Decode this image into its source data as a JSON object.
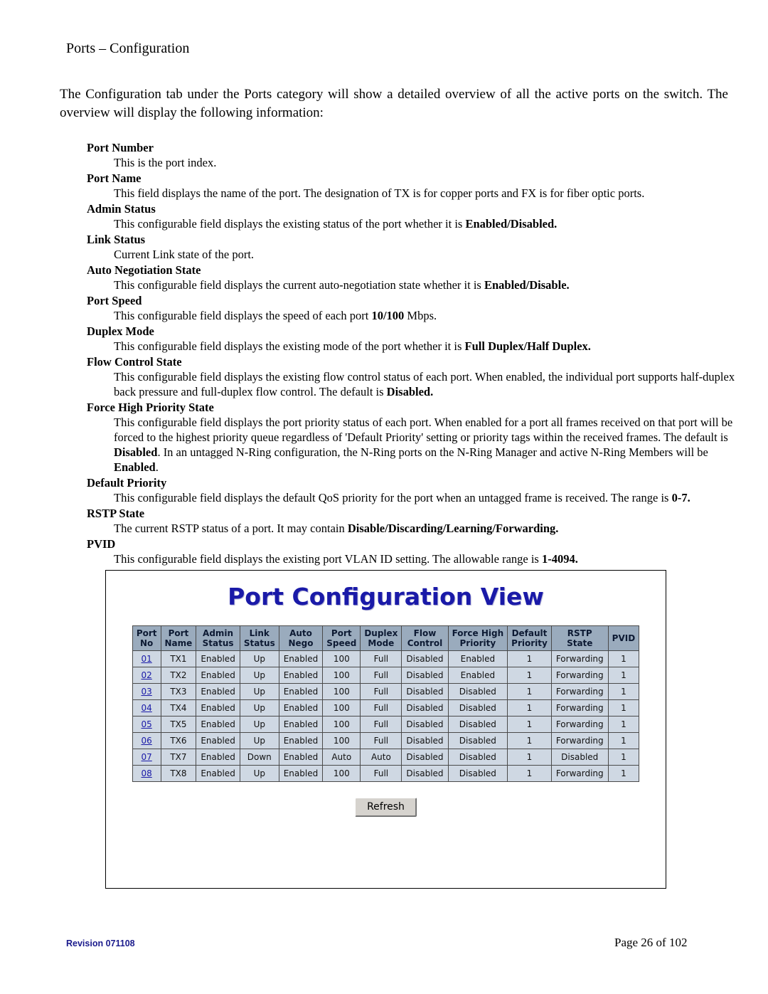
{
  "page": {
    "heading": "Ports – Configuration",
    "intro": "The Configuration tab under the Ports category will show a detailed overview of all the active ports on the switch.  The overview will display the following information:",
    "footer_left": "Revision 071108",
    "footer_right": "Page 26 of 102"
  },
  "definitions": [
    {
      "term": "Port Number",
      "parts": [
        {
          "t": "This is the port index.",
          "b": false
        }
      ]
    },
    {
      "term": "Port Name",
      "parts": [
        {
          "t": "This field displays the name of the port. The designation of TX is for copper ports and FX is for fiber optic ports.",
          "b": false
        }
      ]
    },
    {
      "term": "Admin Status",
      "parts": [
        {
          "t": "This configurable field displays the existing status of the port whether it is ",
          "b": false
        },
        {
          "t": "Enabled/Disabled.",
          "b": true
        }
      ]
    },
    {
      "term": "Link Status",
      "parts": [
        {
          "t": "Current Link state of the port.",
          "b": false
        }
      ]
    },
    {
      "term": "Auto Negotiation State",
      "parts": [
        {
          "t": "This configurable field displays the current auto-negotiation state whether it is ",
          "b": false
        },
        {
          "t": "Enabled/Disable.",
          "b": true
        }
      ]
    },
    {
      "term": "Port Speed",
      "parts": [
        {
          "t": "This configurable field displays the speed of each port ",
          "b": false
        },
        {
          "t": "10/100",
          "b": true
        },
        {
          "t": " Mbps.",
          "b": false
        }
      ]
    },
    {
      "term": "Duplex Mode",
      "parts": [
        {
          "t": "This configurable field displays the existing mode of the port whether it is ",
          "b": false
        },
        {
          "t": "Full Duplex/Half Duplex.",
          "b": true
        }
      ]
    },
    {
      "term": "Flow Control State",
      "parts": [
        {
          "t": "This configurable field displays the existing flow control status of each port. When enabled, the individual port supports half-duplex back pressure and full-duplex flow control. The default is ",
          "b": false
        },
        {
          "t": "Disabled.",
          "b": true
        }
      ]
    },
    {
      "term": "Force High Priority State",
      "parts": [
        {
          "t": "This configurable field displays the port priority status of each port. When enabled for a port all frames received on that port will be forced to the highest priority queue regardless of 'Default Priority' setting or priority tags within the received frames. The default is ",
          "b": false
        },
        {
          "t": "Disabled",
          "b": true
        },
        {
          "t": ". In an untagged N-Ring configuration, the N-Ring ports on the N-Ring Manager and active N-Ring Members will be ",
          "b": false
        },
        {
          "t": "Enabled",
          "b": true
        },
        {
          "t": ".",
          "b": false
        }
      ]
    },
    {
      "term": "Default Priority",
      "parts": [
        {
          "t": "This configurable field displays the default QoS priority for the port when an untagged frame is received. The range is ",
          "b": false
        },
        {
          "t": "0-7.",
          "b": true
        }
      ]
    },
    {
      "term": "RSTP State",
      "parts": [
        {
          "t": "The current RSTP status of a port. It may contain ",
          "b": false
        },
        {
          "t": "Disable/Discarding/Learning/Forwarding.",
          "b": true
        }
      ]
    },
    {
      "term": "PVID",
      "parts": [
        {
          "t": "This configurable field displays the existing port VLAN ID setting. The allowable range is ",
          "b": false
        },
        {
          "t": "1-4094.",
          "b": true
        }
      ]
    }
  ],
  "port_view": {
    "title": "Port Configuration View",
    "refresh_label": "Refresh",
    "columns": [
      {
        "line1": "Port",
        "line2": "No"
      },
      {
        "line1": "Port",
        "line2": "Name"
      },
      {
        "line1": "Admin",
        "line2": "Status"
      },
      {
        "line1": "Link",
        "line2": "Status"
      },
      {
        "line1": "Auto",
        "line2": "Nego"
      },
      {
        "line1": "Port",
        "line2": "Speed"
      },
      {
        "line1": "Duplex",
        "line2": "Mode"
      },
      {
        "line1": "Flow",
        "line2": "Control"
      },
      {
        "line1": "Force High",
        "line2": "Priority"
      },
      {
        "line1": "Default",
        "line2": "Priority"
      },
      {
        "line1": "RSTP",
        "line2": "State"
      },
      {
        "line1": "PVID",
        "line2": ""
      }
    ],
    "rows": [
      {
        "no": "01",
        "name": "TX1",
        "admin": "Enabled",
        "link": "Up",
        "auto": "Enabled",
        "speed": "100",
        "duplex": "Full",
        "flow": "Disabled",
        "force": "Enabled",
        "default": "1",
        "rstp": "Forwarding",
        "pvid": "1"
      },
      {
        "no": "02",
        "name": "TX2",
        "admin": "Enabled",
        "link": "Up",
        "auto": "Enabled",
        "speed": "100",
        "duplex": "Full",
        "flow": "Disabled",
        "force": "Enabled",
        "default": "1",
        "rstp": "Forwarding",
        "pvid": "1"
      },
      {
        "no": "03",
        "name": "TX3",
        "admin": "Enabled",
        "link": "Up",
        "auto": "Enabled",
        "speed": "100",
        "duplex": "Full",
        "flow": "Disabled",
        "force": "Disabled",
        "default": "1",
        "rstp": "Forwarding",
        "pvid": "1"
      },
      {
        "no": "04",
        "name": "TX4",
        "admin": "Enabled",
        "link": "Up",
        "auto": "Enabled",
        "speed": "100",
        "duplex": "Full",
        "flow": "Disabled",
        "force": "Disabled",
        "default": "1",
        "rstp": "Forwarding",
        "pvid": "1"
      },
      {
        "no": "05",
        "name": "TX5",
        "admin": "Enabled",
        "link": "Up",
        "auto": "Enabled",
        "speed": "100",
        "duplex": "Full",
        "flow": "Disabled",
        "force": "Disabled",
        "default": "1",
        "rstp": "Forwarding",
        "pvid": "1"
      },
      {
        "no": "06",
        "name": "TX6",
        "admin": "Enabled",
        "link": "Up",
        "auto": "Enabled",
        "speed": "100",
        "duplex": "Full",
        "flow": "Disabled",
        "force": "Disabled",
        "default": "1",
        "rstp": "Forwarding",
        "pvid": "1"
      },
      {
        "no": "07",
        "name": "TX7",
        "admin": "Enabled",
        "link": "Down",
        "auto": "Enabled",
        "speed": "Auto",
        "duplex": "Auto",
        "flow": "Disabled",
        "force": "Disabled",
        "default": "1",
        "rstp": "Disabled",
        "pvid": "1"
      },
      {
        "no": "08",
        "name": "TX8",
        "admin": "Enabled",
        "link": "Up",
        "auto": "Enabled",
        "speed": "100",
        "duplex": "Full",
        "flow": "Disabled",
        "force": "Disabled",
        "default": "1",
        "rstp": "Forwarding",
        "pvid": "1"
      }
    ]
  }
}
